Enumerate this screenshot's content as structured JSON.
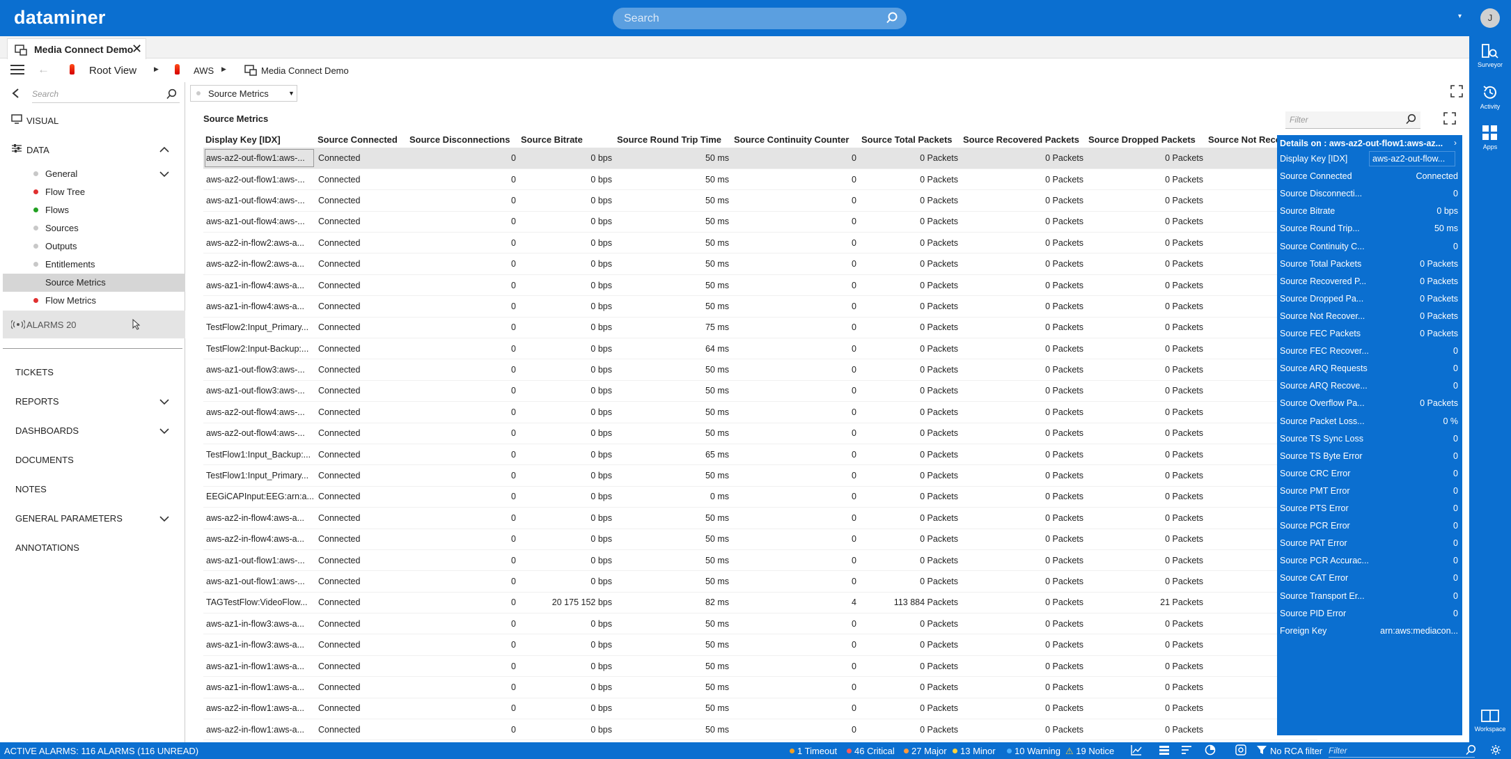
{
  "app": {
    "logo": "dataminer",
    "user_initial": "J",
    "search_placeholder": "Search"
  },
  "rail": [
    {
      "label": "Surveyor",
      "icon": "surveyor-icon"
    },
    {
      "label": "Activity",
      "icon": "history-icon"
    },
    {
      "label": "Apps",
      "icon": "apps-grid-icon"
    },
    {
      "label": "Workspace",
      "icon": "workspace-icon"
    }
  ],
  "tab": {
    "label": "Media Connect Demo"
  },
  "breadcrumb": {
    "root": "Root View",
    "aws": "AWS",
    "element": "Media Connect Demo"
  },
  "left": {
    "search_placeholder": "Search",
    "visual": "VISUAL",
    "data": "DATA",
    "data_items": [
      {
        "label": "General",
        "color": "#c8c8c8"
      },
      {
        "label": "Flow Tree",
        "color": "#e03030"
      },
      {
        "label": "Flows",
        "color": "#22a022"
      },
      {
        "label": "Sources",
        "color": "#c8c8c8"
      },
      {
        "label": "Outputs",
        "color": "#c8c8c8"
      },
      {
        "label": "Entitlements",
        "color": "#c8c8c8"
      },
      {
        "label": "Source Metrics",
        "color": ""
      },
      {
        "label": "Flow Metrics",
        "color": "#e03030"
      }
    ],
    "alarms_label": "ALARMS 20",
    "sections": [
      "TICKETS",
      "REPORTS",
      "DASHBOARDS",
      "DOCUMENTS",
      "NOTES",
      "GENERAL PARAMETERS",
      "ANNOTATIONS"
    ]
  },
  "main": {
    "table_select": "Source Metrics",
    "title": "Source Metrics",
    "filter_placeholder": "Filter",
    "columns": [
      "Display Key [IDX]",
      "Source Connected",
      "Source Disconnections",
      "Source Bitrate",
      "Source Round Trip Time",
      "Source Continuity Counter",
      "Source Total Packets",
      "Source Recovered Packets",
      "Source Dropped Packets",
      "Source Not Reco"
    ],
    "rows": [
      [
        "aws-az2-out-flow1:aws-...",
        "Connected",
        "0",
        "0 bps",
        "50 ms",
        "0",
        "0 Packets",
        "0 Packets",
        "0 Packets"
      ],
      [
        "aws-az2-out-flow1:aws-...",
        "Connected",
        "0",
        "0 bps",
        "50 ms",
        "0",
        "0 Packets",
        "0 Packets",
        "0 Packets"
      ],
      [
        "aws-az1-out-flow4:aws-...",
        "Connected",
        "0",
        "0 bps",
        "50 ms",
        "0",
        "0 Packets",
        "0 Packets",
        "0 Packets"
      ],
      [
        "aws-az1-out-flow4:aws-...",
        "Connected",
        "0",
        "0 bps",
        "50 ms",
        "0",
        "0 Packets",
        "0 Packets",
        "0 Packets"
      ],
      [
        "aws-az2-in-flow2:aws-a...",
        "Connected",
        "0",
        "0 bps",
        "50 ms",
        "0",
        "0 Packets",
        "0 Packets",
        "0 Packets"
      ],
      [
        "aws-az2-in-flow2:aws-a...",
        "Connected",
        "0",
        "0 bps",
        "50 ms",
        "0",
        "0 Packets",
        "0 Packets",
        "0 Packets"
      ],
      [
        "aws-az1-in-flow4:aws-a...",
        "Connected",
        "0",
        "0 bps",
        "50 ms",
        "0",
        "0 Packets",
        "0 Packets",
        "0 Packets"
      ],
      [
        "aws-az1-in-flow4:aws-a...",
        "Connected",
        "0",
        "0 bps",
        "50 ms",
        "0",
        "0 Packets",
        "0 Packets",
        "0 Packets"
      ],
      [
        "TestFlow2:Input_Primary...",
        "Connected",
        "0",
        "0 bps",
        "75 ms",
        "0",
        "0 Packets",
        "0 Packets",
        "0 Packets"
      ],
      [
        "TestFlow2:Input-Backup:...",
        "Connected",
        "0",
        "0 bps",
        "64 ms",
        "0",
        "0 Packets",
        "0 Packets",
        "0 Packets"
      ],
      [
        "aws-az1-out-flow3:aws-...",
        "Connected",
        "0",
        "0 bps",
        "50 ms",
        "0",
        "0 Packets",
        "0 Packets",
        "0 Packets"
      ],
      [
        "aws-az1-out-flow3:aws-...",
        "Connected",
        "0",
        "0 bps",
        "50 ms",
        "0",
        "0 Packets",
        "0 Packets",
        "0 Packets"
      ],
      [
        "aws-az2-out-flow4:aws-...",
        "Connected",
        "0",
        "0 bps",
        "50 ms",
        "0",
        "0 Packets",
        "0 Packets",
        "0 Packets"
      ],
      [
        "aws-az2-out-flow4:aws-...",
        "Connected",
        "0",
        "0 bps",
        "50 ms",
        "0",
        "0 Packets",
        "0 Packets",
        "0 Packets"
      ],
      [
        "TestFlow1:Input_Backup:...",
        "Connected",
        "0",
        "0 bps",
        "65 ms",
        "0",
        "0 Packets",
        "0 Packets",
        "0 Packets"
      ],
      [
        "TestFlow1:Input_Primary...",
        "Connected",
        "0",
        "0 bps",
        "50 ms",
        "0",
        "0 Packets",
        "0 Packets",
        "0 Packets"
      ],
      [
        "EEGiCAPInput:EEG:arn:a...",
        "Connected",
        "0",
        "0 bps",
        "0 ms",
        "0",
        "0 Packets",
        "0 Packets",
        "0 Packets"
      ],
      [
        "aws-az2-in-flow4:aws-a...",
        "Connected",
        "0",
        "0 bps",
        "50 ms",
        "0",
        "0 Packets",
        "0 Packets",
        "0 Packets"
      ],
      [
        "aws-az2-in-flow4:aws-a...",
        "Connected",
        "0",
        "0 bps",
        "50 ms",
        "0",
        "0 Packets",
        "0 Packets",
        "0 Packets"
      ],
      [
        "aws-az1-out-flow1:aws-...",
        "Connected",
        "0",
        "0 bps",
        "50 ms",
        "0",
        "0 Packets",
        "0 Packets",
        "0 Packets"
      ],
      [
        "aws-az1-out-flow1:aws-...",
        "Connected",
        "0",
        "0 bps",
        "50 ms",
        "0",
        "0 Packets",
        "0 Packets",
        "0 Packets"
      ],
      [
        "TAGTestFlow:VideoFlow...",
        "Connected",
        "0",
        "20 175 152 bps",
        "82 ms",
        "4",
        "113 884 Packets",
        "0 Packets",
        "21 Packets"
      ],
      [
        "aws-az1-in-flow3:aws-a...",
        "Connected",
        "0",
        "0 bps",
        "50 ms",
        "0",
        "0 Packets",
        "0 Packets",
        "0 Packets"
      ],
      [
        "aws-az1-in-flow3:aws-a...",
        "Connected",
        "0",
        "0 bps",
        "50 ms",
        "0",
        "0 Packets",
        "0 Packets",
        "0 Packets"
      ],
      [
        "aws-az1-in-flow1:aws-a...",
        "Connected",
        "0",
        "0 bps",
        "50 ms",
        "0",
        "0 Packets",
        "0 Packets",
        "0 Packets"
      ],
      [
        "aws-az1-in-flow1:aws-a...",
        "Connected",
        "0",
        "0 bps",
        "50 ms",
        "0",
        "0 Packets",
        "0 Packets",
        "0 Packets"
      ],
      [
        "aws-az2-in-flow1:aws-a...",
        "Connected",
        "0",
        "0 bps",
        "50 ms",
        "0",
        "0 Packets",
        "0 Packets",
        "0 Packets"
      ],
      [
        "aws-az2-in-flow1:aws-a...",
        "Connected",
        "0",
        "0 bps",
        "50 ms",
        "0",
        "0 Packets",
        "0 Packets",
        "0 Packets"
      ]
    ]
  },
  "details": {
    "title": "Details on : aws-az2-out-flow1:aws-az...",
    "items": [
      {
        "key": "Display Key [IDX]",
        "value": "aws-az2-out-flow..."
      },
      {
        "key": "Source Connected",
        "value": "Connected"
      },
      {
        "key": "Source Disconnecti...",
        "value": "0"
      },
      {
        "key": "Source Bitrate",
        "value": "0 bps"
      },
      {
        "key": "Source Round Trip...",
        "value": "50 ms"
      },
      {
        "key": "Source Continuity C...",
        "value": "0"
      },
      {
        "key": "Source Total Packets",
        "value": "0 Packets"
      },
      {
        "key": "Source Recovered P...",
        "value": "0 Packets"
      },
      {
        "key": "Source Dropped Pa...",
        "value": "0 Packets"
      },
      {
        "key": "Source Not Recover...",
        "value": "0 Packets"
      },
      {
        "key": "Source FEC Packets",
        "value": "0 Packets"
      },
      {
        "key": "Source FEC Recover...",
        "value": "0"
      },
      {
        "key": "Source ARQ Requests",
        "value": "0"
      },
      {
        "key": "Source ARQ Recove...",
        "value": "0"
      },
      {
        "key": "Source Overflow Pa...",
        "value": "0 Packets"
      },
      {
        "key": "Source Packet Loss...",
        "value": "0 %"
      },
      {
        "key": "Source TS Sync Loss",
        "value": "0"
      },
      {
        "key": "Source TS Byte Error",
        "value": "0"
      },
      {
        "key": "Source CRC Error",
        "value": "0"
      },
      {
        "key": "Source PMT Error",
        "value": "0"
      },
      {
        "key": "Source PTS Error",
        "value": "0"
      },
      {
        "key": "Source PCR Error",
        "value": "0"
      },
      {
        "key": "Source PAT Error",
        "value": "0"
      },
      {
        "key": "Source PCR Accurac...",
        "value": "0"
      },
      {
        "key": "Source CAT Error",
        "value": "0"
      },
      {
        "key": "Source Transport Er...",
        "value": "0"
      },
      {
        "key": "Source PID Error",
        "value": "0"
      },
      {
        "key": "Foreign Key",
        "value": "arn:aws:mediacon..."
      }
    ]
  },
  "status": {
    "active_alarms": "ACTIVE ALARMS: 116 ALARMS (116 UNREAD)",
    "timeout": "1 Timeout",
    "critical": "46 Critical",
    "major": "27 Major",
    "minor": "13 Minor",
    "warning": "10 Warning",
    "notice": "19 Notice",
    "rca": "No RCA filter",
    "filter_placeholder": "Filter",
    "colors": {
      "timeout": "#f4a020",
      "critical": "#ff5a5a",
      "major": "#ff9a3c",
      "minor": "#ffd33c",
      "warning": "#4ab0ff",
      "notice": "#ffd33c"
    }
  }
}
